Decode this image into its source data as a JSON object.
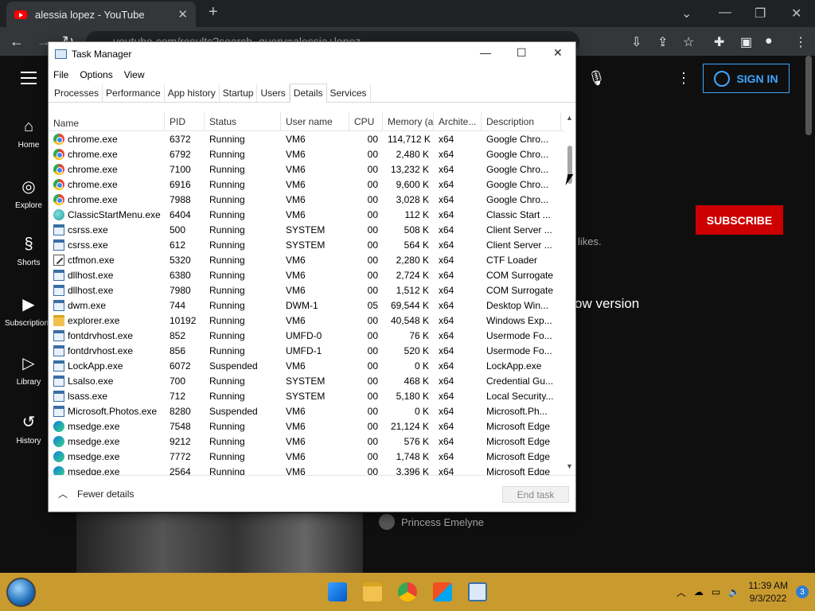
{
  "browser": {
    "tab_title": "alessia lopez - YouTube",
    "url": "youtube.com/results?search_query=alessia+lopez"
  },
  "youtube": {
    "nav": [
      {
        "label": "Home",
        "icon": "home-icon"
      },
      {
        "label": "Explore",
        "icon": "compass-icon"
      },
      {
        "label": "Shorts",
        "icon": "shorts-icon"
      },
      {
        "label": "Subscriptions",
        "icon": "subscriptions-icon"
      },
      {
        "label": "Library",
        "icon": "library-icon"
      },
      {
        "label": "History",
        "icon": "history-icon"
      }
    ],
    "sign_in": "SIGN IN",
    "subscribe": "SUBSCRIBE",
    "likes_text": "likes.",
    "new_version_text": "ow version",
    "channel_name": "Princess Emelyne"
  },
  "task_manager": {
    "title": "Task Manager",
    "menu": [
      "File",
      "Options",
      "View"
    ],
    "tabs": [
      "Processes",
      "Performance",
      "App history",
      "Startup",
      "Users",
      "Details",
      "Services"
    ],
    "active_tab": "Details",
    "columns": [
      "Name",
      "PID",
      "Status",
      "User name",
      "CPU",
      "Memory (a...",
      "Archite...",
      "Description"
    ],
    "rows": [
      {
        "icon": "chrome",
        "name": "chrome.exe",
        "pid": "6372",
        "status": "Running",
        "user": "VM6",
        "cpu": "00",
        "mem": "114,712 K",
        "arch": "x64",
        "desc": "Google Chro..."
      },
      {
        "icon": "chrome",
        "name": "chrome.exe",
        "pid": "6792",
        "status": "Running",
        "user": "VM6",
        "cpu": "00",
        "mem": "2,480 K",
        "arch": "x64",
        "desc": "Google Chro..."
      },
      {
        "icon": "chrome",
        "name": "chrome.exe",
        "pid": "7100",
        "status": "Running",
        "user": "VM6",
        "cpu": "00",
        "mem": "13,232 K",
        "arch": "x64",
        "desc": "Google Chro..."
      },
      {
        "icon": "chrome",
        "name": "chrome.exe",
        "pid": "6916",
        "status": "Running",
        "user": "VM6",
        "cpu": "00",
        "mem": "9,600 K",
        "arch": "x64",
        "desc": "Google Chro..."
      },
      {
        "icon": "chrome",
        "name": "chrome.exe",
        "pid": "7988",
        "status": "Running",
        "user": "VM6",
        "cpu": "00",
        "mem": "3,028 K",
        "arch": "x64",
        "desc": "Google Chro..."
      },
      {
        "icon": "globe",
        "name": "ClassicStartMenu.exe",
        "pid": "6404",
        "status": "Running",
        "user": "VM6",
        "cpu": "00",
        "mem": "112 K",
        "arch": "x64",
        "desc": "Classic Start ..."
      },
      {
        "icon": "win",
        "name": "csrss.exe",
        "pid": "500",
        "status": "Running",
        "user": "SYSTEM",
        "cpu": "00",
        "mem": "508 K",
        "arch": "x64",
        "desc": "Client Server ..."
      },
      {
        "icon": "win",
        "name": "csrss.exe",
        "pid": "612",
        "status": "Running",
        "user": "SYSTEM",
        "cpu": "00",
        "mem": "564 K",
        "arch": "x64",
        "desc": "Client Server ..."
      },
      {
        "icon": "pen",
        "name": "ctfmon.exe",
        "pid": "5320",
        "status": "Running",
        "user": "VM6",
        "cpu": "00",
        "mem": "2,280 K",
        "arch": "x64",
        "desc": "CTF Loader"
      },
      {
        "icon": "win",
        "name": "dllhost.exe",
        "pid": "6380",
        "status": "Running",
        "user": "VM6",
        "cpu": "00",
        "mem": "2,724 K",
        "arch": "x64",
        "desc": "COM Surrogate"
      },
      {
        "icon": "win",
        "name": "dllhost.exe",
        "pid": "7980",
        "status": "Running",
        "user": "VM6",
        "cpu": "00",
        "mem": "1,512 K",
        "arch": "x64",
        "desc": "COM Surrogate"
      },
      {
        "icon": "win",
        "name": "dwm.exe",
        "pid": "744",
        "status": "Running",
        "user": "DWM-1",
        "cpu": "05",
        "mem": "69,544 K",
        "arch": "x64",
        "desc": "Desktop Win..."
      },
      {
        "icon": "folder",
        "name": "explorer.exe",
        "pid": "10192",
        "status": "Running",
        "user": "VM6",
        "cpu": "00",
        "mem": "40,548 K",
        "arch": "x64",
        "desc": "Windows Exp..."
      },
      {
        "icon": "win",
        "name": "fontdrvhost.exe",
        "pid": "852",
        "status": "Running",
        "user": "UMFD-0",
        "cpu": "00",
        "mem": "76 K",
        "arch": "x64",
        "desc": "Usermode Fo..."
      },
      {
        "icon": "win",
        "name": "fontdrvhost.exe",
        "pid": "856",
        "status": "Running",
        "user": "UMFD-1",
        "cpu": "00",
        "mem": "520 K",
        "arch": "x64",
        "desc": "Usermode Fo..."
      },
      {
        "icon": "win",
        "name": "LockApp.exe",
        "pid": "6072",
        "status": "Suspended",
        "user": "VM6",
        "cpu": "00",
        "mem": "0 K",
        "arch": "x64",
        "desc": "LockApp.exe"
      },
      {
        "icon": "win",
        "name": "Lsalso.exe",
        "pid": "700",
        "status": "Running",
        "user": "SYSTEM",
        "cpu": "00",
        "mem": "468 K",
        "arch": "x64",
        "desc": "Credential Gu..."
      },
      {
        "icon": "win",
        "name": "lsass.exe",
        "pid": "712",
        "status": "Running",
        "user": "SYSTEM",
        "cpu": "00",
        "mem": "5,180 K",
        "arch": "x64",
        "desc": "Local Security..."
      },
      {
        "icon": "win",
        "name": "Microsoft.Photos.exe",
        "pid": "8280",
        "status": "Suspended",
        "user": "VM6",
        "cpu": "00",
        "mem": "0 K",
        "arch": "x64",
        "desc": "Microsoft.Ph..."
      },
      {
        "icon": "edge",
        "name": "msedge.exe",
        "pid": "7548",
        "status": "Running",
        "user": "VM6",
        "cpu": "00",
        "mem": "21,124 K",
        "arch": "x64",
        "desc": "Microsoft Edge"
      },
      {
        "icon": "edge",
        "name": "msedge.exe",
        "pid": "9212",
        "status": "Running",
        "user": "VM6",
        "cpu": "00",
        "mem": "576 K",
        "arch": "x64",
        "desc": "Microsoft Edge"
      },
      {
        "icon": "edge",
        "name": "msedge.exe",
        "pid": "7772",
        "status": "Running",
        "user": "VM6",
        "cpu": "00",
        "mem": "1,748 K",
        "arch": "x64",
        "desc": "Microsoft Edge"
      },
      {
        "icon": "edge",
        "name": "msedge.exe",
        "pid": "2564",
        "status": "Running",
        "user": "VM6",
        "cpu": "00",
        "mem": "3,396 K",
        "arch": "x64",
        "desc": "Microsoft Edge"
      }
    ],
    "fewer_details": "Fewer details",
    "end_task": "End task"
  },
  "taskbar": {
    "time": "11:39 AM",
    "date": "9/3/2022",
    "notification_count": "3"
  },
  "colors": {
    "youtube_red": "#ff0000",
    "subscribe_red": "#cc0000",
    "signin_blue": "#3ea6ff",
    "taskbar": "#c99a2e"
  }
}
